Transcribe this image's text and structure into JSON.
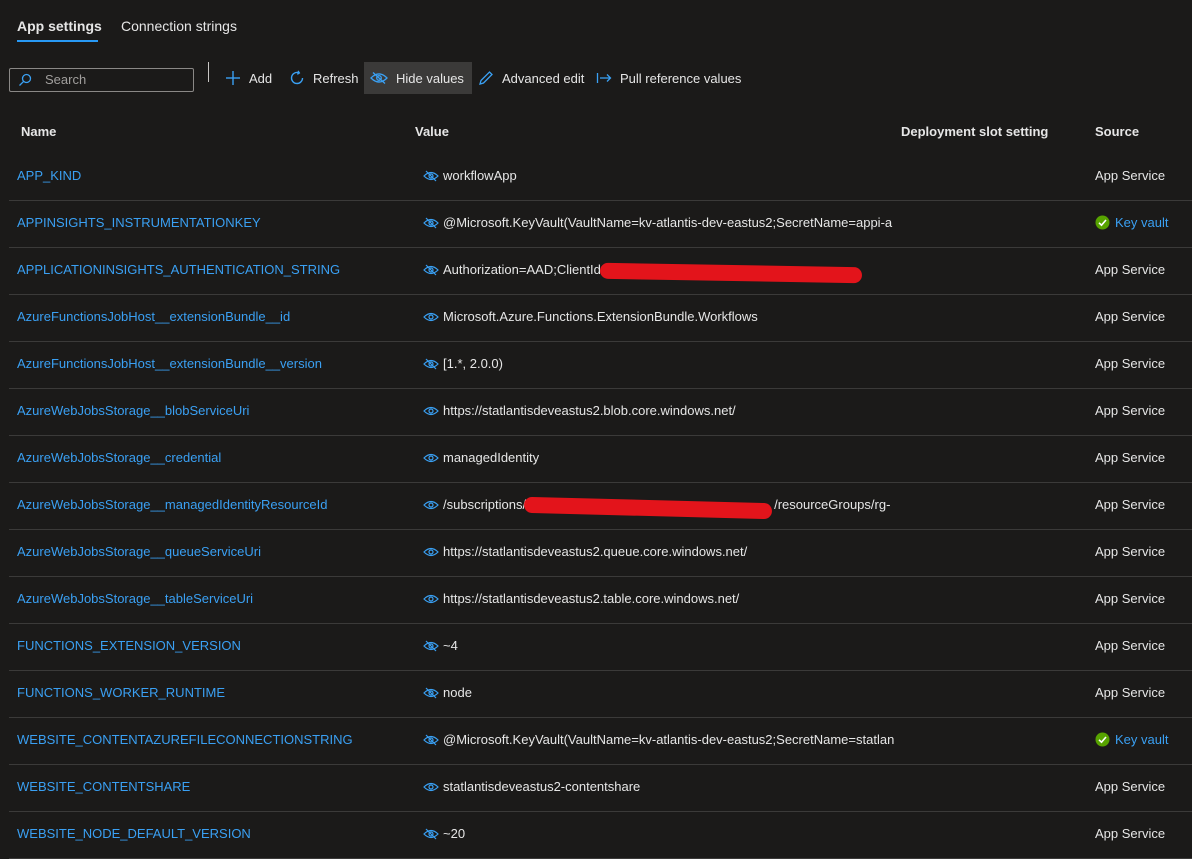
{
  "tabs": [
    {
      "label": "App settings",
      "active": true
    },
    {
      "label": "Connection strings",
      "active": false
    }
  ],
  "toolbar": {
    "search_placeholder": "Search",
    "add_label": "Add",
    "refresh_label": "Refresh",
    "hide_values_label": "Hide values",
    "advanced_edit_label": "Advanced edit",
    "pull_reference_label": "Pull reference values"
  },
  "columns": {
    "name": "Name",
    "value": "Value",
    "slot": "Deployment slot setting",
    "source": "Source"
  },
  "rows": [
    {
      "name": "APP_KIND",
      "value": "workflowApp",
      "source": "App Service"
    },
    {
      "name": "APPINSIGHTS_INSTRUMENTATIONKEY",
      "value": "@Microsoft.KeyVault(VaultName=kv-atlantis-dev-eastus2;SecretName=appi-a",
      "source": "Key vault"
    },
    {
      "name": "APPLICATIONINSIGHTS_AUTHENTICATION_STRING",
      "value": "Authorization=AAD;ClientId=",
      "source": "App Service"
    },
    {
      "name": "AzureFunctionsJobHost__extensionBundle__id",
      "value": "Microsoft.Azure.Functions.ExtensionBundle.Workflows",
      "source": "App Service"
    },
    {
      "name": "AzureFunctionsJobHost__extensionBundle__version",
      "value": "[1.*, 2.0.0)",
      "source": "App Service"
    },
    {
      "name": "AzureWebJobsStorage__blobServiceUri",
      "value": "https://statlantisdeveastus2.blob.core.windows.net/",
      "source": "App Service"
    },
    {
      "name": "AzureWebJobsStorage__credential",
      "value": "managedIdentity",
      "source": "App Service"
    },
    {
      "name": "AzureWebJobsStorage__managedIdentityResourceId",
      "value": "/subscriptions/",
      "value_suffix": "/resourceGroups/rg-",
      "source": "App Service"
    },
    {
      "name": "AzureWebJobsStorage__queueServiceUri",
      "value": "https://statlantisdeveastus2.queue.core.windows.net/",
      "source": "App Service"
    },
    {
      "name": "AzureWebJobsStorage__tableServiceUri",
      "value": "https://statlantisdeveastus2.table.core.windows.net/",
      "source": "App Service"
    },
    {
      "name": "FUNCTIONS_EXTENSION_VERSION",
      "value": "~4",
      "source": "App Service"
    },
    {
      "name": "FUNCTIONS_WORKER_RUNTIME",
      "value": "node",
      "source": "App Service"
    },
    {
      "name": "WEBSITE_CONTENTAZUREFILECONNECTIONSTRING",
      "value": "@Microsoft.KeyVault(VaultName=kv-atlantis-dev-eastus2;SecretName=statlan",
      "source": "Key vault"
    },
    {
      "name": "WEBSITE_CONTENTSHARE",
      "value": "statlantisdeveastus2-contentshare",
      "source": "App Service"
    },
    {
      "name": "WEBSITE_NODE_DEFAULT_VERSION",
      "value": "~20",
      "source": "App Service"
    }
  ],
  "colors": {
    "background": "#1b1a19",
    "link": "#3aa0f3",
    "accent": "#2899f5",
    "success": "#57a300",
    "redaction": "#e3141b"
  }
}
